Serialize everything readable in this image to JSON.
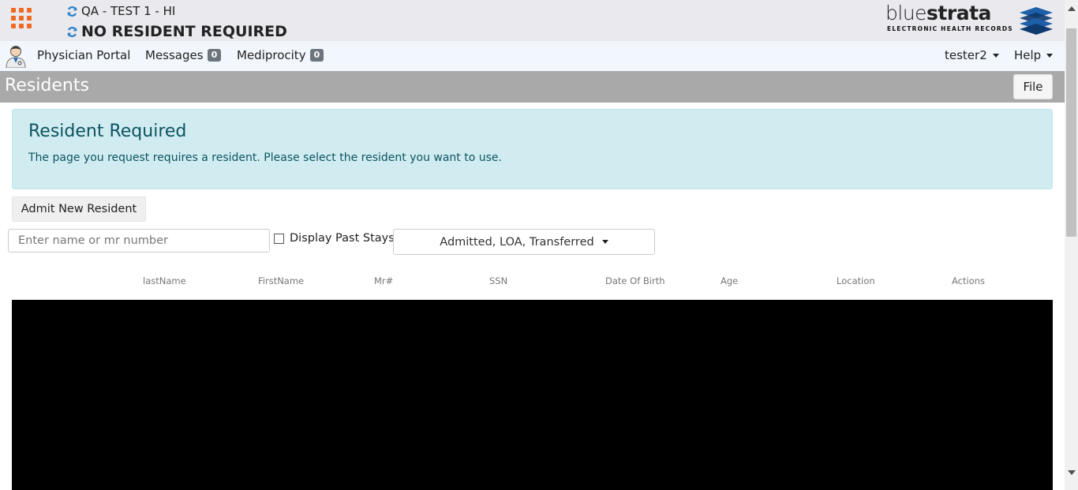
{
  "header": {
    "facility": "QA - TEST 1 - HI",
    "resident": "NO RESIDENT REQUIRED",
    "logo": {
      "brand_light": "blue",
      "brand_bold": "strata",
      "tagline": "ELECTRONIC HEALTH RECORDS"
    }
  },
  "nav": {
    "items": [
      {
        "label": "Physician Portal"
      },
      {
        "label": "Messages",
        "badge": "0"
      },
      {
        "label": "Mediprocity",
        "badge": "0"
      }
    ],
    "user": "tester2",
    "help": "Help"
  },
  "titlebar": {
    "title": "Residents",
    "file_label": "File"
  },
  "alert": {
    "title": "Resident Required",
    "text": "The page you request requires a resident. Please select the resident you want to use."
  },
  "admit_label": "Admit New Resident",
  "filters": {
    "search_placeholder": "Enter name or mr number",
    "past_stays_label": "Display Past Stays",
    "status_selected": "Admitted, LOA, Transferred"
  },
  "table": {
    "columns": [
      "lastName",
      "FirstName",
      "Mr#",
      "SSN",
      "Date Of Birth",
      "Age",
      "Location",
      "Actions"
    ]
  },
  "colors": {
    "accent_orange": "#f06a24",
    "refresh_blue": "#2a7fc9",
    "alert_bg": "#d1ecf1",
    "alert_text": "#0c5460",
    "titlebar_bg": "#a9a9a9"
  }
}
